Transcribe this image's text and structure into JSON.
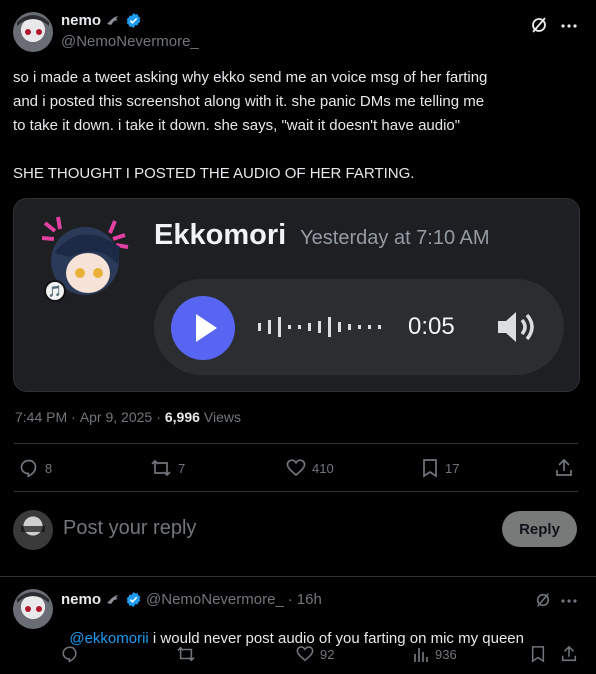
{
  "tweet": {
    "author_name": "nemo",
    "author_handle": "@NemoNevermore_",
    "text": "so i made a tweet asking why ekko send me an voice msg of her farting\nand i posted this screenshot along with it. she panic DMs me telling me\nto take it down. i take it down. she says, \"wait it doesn't have audio\"\n\nSHE THOUGHT I POSTED THE AUDIO OF HER FARTING.",
    "time": "7:44 PM",
    "sep": "·",
    "date": "Apr 9, 2025",
    "views_count": "6,996",
    "views_label": "Views",
    "stats": {
      "replies": "8",
      "reposts": "7",
      "likes": "410",
      "bookmarks": "17"
    }
  },
  "media": {
    "username": "Ekkomori",
    "timestamp": "Yesterday at 7:10 AM",
    "duration": "0:05"
  },
  "reply_box": {
    "placeholder": "Post your reply",
    "button_label": "Reply"
  },
  "reply": {
    "author_name": "nemo",
    "author_handle": "@NemoNevermore_",
    "sep": "·",
    "time": "16h",
    "mention": "@ekkomorii",
    "text": " i would never post audio of you farting on mic my queen",
    "stats": {
      "replies": "",
      "reposts": "",
      "likes": "92",
      "views": "936"
    }
  },
  "colors": {
    "accent": "#1d9bf0",
    "discord_blurple": "#5865f2",
    "muted": "#71767b"
  }
}
